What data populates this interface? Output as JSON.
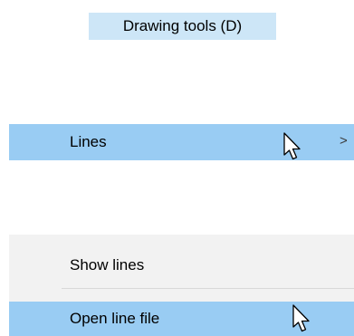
{
  "tooltip": {
    "text": "Drawing tools (D)"
  },
  "menu": {
    "lines_label": "Lines",
    "lines_chevron": ">"
  },
  "submenu": {
    "items": [
      {
        "label": "Show lines"
      },
      {
        "label": "Open line file"
      }
    ]
  },
  "icons": {
    "cursor": "mouse-pointer-icon",
    "submenu_arrow": "chevron-right-icon"
  },
  "colors": {
    "tooltip_bg": "#cde6f7",
    "highlight_bg": "#99ccf3",
    "submenu_bg": "#f2f2f2"
  }
}
